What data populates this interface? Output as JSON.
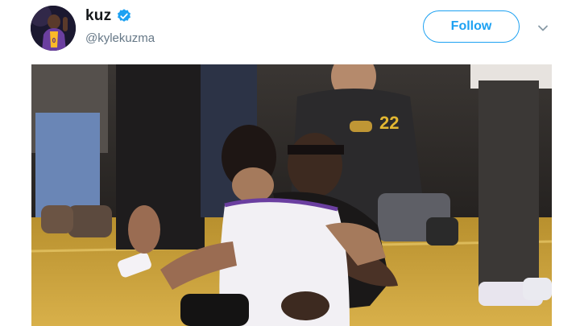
{
  "tweet": {
    "author": {
      "display_name": "kuz",
      "handle": "@kylekuzma",
      "verified": true,
      "avatar_icon": "player-avatar"
    },
    "follow_button": {
      "label": "Follow"
    },
    "menu_icon": "chevron-down-icon",
    "media": {
      "kind": "video-still",
      "scene_text": "22"
    }
  },
  "colors": {
    "accent": "#1da1f2",
    "name": "#14171a",
    "handle": "#657786",
    "lakers_purple": "#552583",
    "lakers_gold": "#fdb927"
  }
}
